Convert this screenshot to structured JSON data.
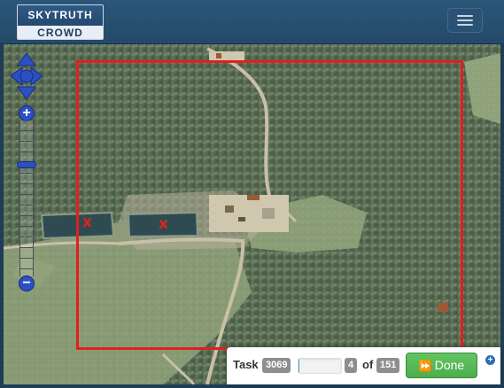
{
  "brand": {
    "line1": "SKYTRUTH",
    "line2": "CROWD"
  },
  "navbar": {
    "menu_icon": "hamburger-icon"
  },
  "map": {
    "pan_icon": "four-arrow-pan-icon",
    "zoom_in_label": "+",
    "zoom_out_label": "−",
    "zoom_level_fraction": 0.27,
    "markers": [
      "x",
      "x"
    ],
    "colors": {
      "task_border": "#e21f1f",
      "marker": "#e0231c",
      "zoom_control": "#2c4fc4"
    }
  },
  "task_panel": {
    "task_label": "Task",
    "task_id": "3069",
    "progress_fraction": 0.027,
    "current": "4",
    "of_label": "of",
    "total": "151",
    "done_label": "Done",
    "done_icon": "fast-forward-icon",
    "expand_icon": "plus-circle-icon",
    "done_color": "#5cb85c"
  }
}
